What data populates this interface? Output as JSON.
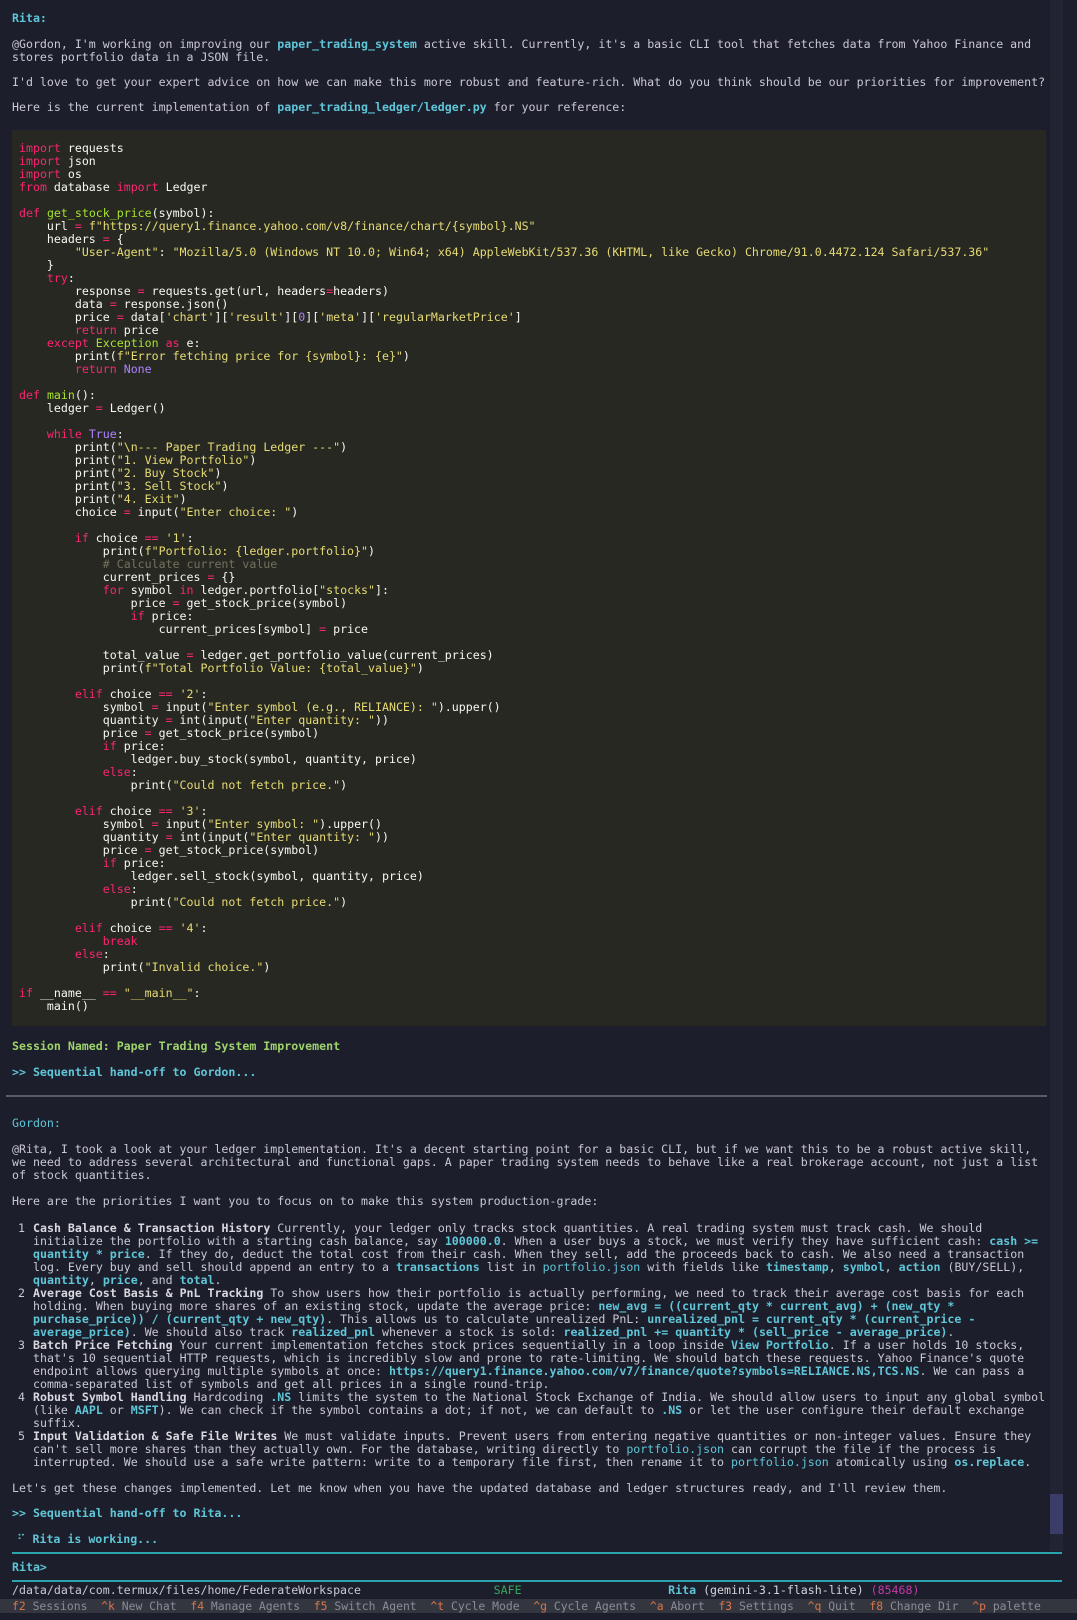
{
  "rita_block": {
    "speaker": "Rita:",
    "p1_a": "@Gordon, I'm working on improving our ",
    "p1_skill": "paper_trading_system",
    "p1_b": " active skill. Currently, it's a basic CLI tool that fetches data from Yahoo Finance and",
    "p1_c": "stores portfolio data in a JSON file.",
    "p2": "I'd love to get your expert advice on how we can make this more robust and feature-rich. What do you think should be our priorities for improvement?",
    "p3_a": "Here is the current implementation of ",
    "p3_file": "paper_trading_ledger/ledger.py",
    "p3_b": " for your reference:"
  },
  "session": {
    "named": "Session Named: Paper Trading System Improvement",
    "handoff_gordon": ">> Sequential hand-off to Gordon..."
  },
  "gordon_block": {
    "speaker": "Gordon:",
    "intro_1": "@Rita, I took a look at your ledger implementation. It's a decent starting point for a basic CLI, but if we want this to be a robust active skill,",
    "intro_2": "we need to address several architectural and functional gaps. A paper trading system needs to behave like a real brokerage account, not just a list",
    "intro_3": "of stock quantities.",
    "priorities": "Here are the priorities I want you to focus on to make this system production-grade:",
    "items": [
      {
        "num": "1",
        "title": "Cash Balance & Transaction History",
        "t1": " Currently, your ledger only tracks stock quantities. A real trading system must track cash. We should initialize the portfolio with a starting cash balance, say ",
        "c1": "100000.0",
        "t2": ". When a user buys a stock, we must verify they have sufficient cash: ",
        "c2": "cash >= quantity * price",
        "t3": ". If they do, deduct the total cost from their cash. When they sell, add the proceeds back to cash. We also need a transaction log. Every buy and sell should append an entry to a ",
        "c3": "transactions",
        "t4": " list in ",
        "c4": "portfolio.json",
        "t5": " with fields like ",
        "c5": "timestamp",
        "t6": ", ",
        "c6": "symbol",
        "t7": ", ",
        "c7": "action",
        "t8": " (BUY/SELL), ",
        "c8": "quantity",
        "t9": ", ",
        "c9": "price",
        "t10": ", and ",
        "c10": "total",
        "t11": "."
      },
      {
        "num": "2",
        "title": "Average Cost Basis & PnL Tracking",
        "t1": " To show users how their portfolio is actually performing, we need to track their average cost basis for each holding. When buying more shares of an existing stock, update the average price: ",
        "c1": "new_avg = ((current_qty * current_avg) + (new_qty * purchase_price)) / (current_qty + new_qty)",
        "t2": ". This allows us to calculate unrealized PnL: ",
        "c2": "unrealized_pnl = current_qty * (current_price - average_price)",
        "t3": ". We should also track ",
        "c3": "realized_pnl",
        "t4": " whenever a stock is sold: ",
        "c4": "realized_pnl += quantity * (sell_price - average_price)",
        "t5": "."
      },
      {
        "num": "3",
        "title": "Batch Price Fetching",
        "t1": " Your current implementation fetches stock prices sequentially in a loop inside ",
        "c1": "View Portfolio",
        "t2": ". If a user holds 10 stocks, that's 10 sequential HTTP requests, which is incredibly slow and prone to rate-limiting. We should batch these requests. Yahoo Finance's quote endpoint allows querying multiple symbols at once: ",
        "c2": "https://query1.finance.yahoo.com/v7/finance/quote?symbols=RELIANCE.NS,TCS.NS",
        "t3": ". We can pass a comma-separated list of symbols and get all prices in a single round-trip."
      },
      {
        "num": "4",
        "title": "Robust Symbol Handling",
        "t1": " Hardcoding ",
        "c1": ".NS",
        "t2": " limits the system to the National Stock Exchange of India. We should allow users to input any global symbol (like ",
        "c2": "AAPL",
        "t3": " or ",
        "c3": "MSFT",
        "t4": "). We can check if the symbol contains a dot; if not, we can default to ",
        "c4": ".NS",
        "t5": " or let the user configure their default exchange suffix."
      },
      {
        "num": "5",
        "title": "Input Validation & Safe File Writes",
        "t1": " We must validate inputs. Prevent users from entering negative quantities or non-integer values. Ensure they can't sell more shares than they actually own. For the database, writing directly to ",
        "c1": "portfolio.json",
        "t2": " can corrupt the file if the process is interrupted. We should use a safe write pattern: write to a temporary file first, then rename it to ",
        "c2": "portfolio.json",
        "t3": " atomically using ",
        "c3": "os.replace",
        "t4": "."
      }
    ],
    "closing": "Let's get these changes implemented. Let me know when you have the updated database and ledger structures ready, and I'll review them.",
    "handoff_rita": ">> Sequential hand-off to Rita...",
    "working": "Rita is working..."
  },
  "input": {
    "prompt": "Rita>"
  },
  "status": {
    "path": "/data/data/com.termux/files/home/FederateWorkspace",
    "mode": "SAFE",
    "agent": "Rita",
    "model": "(gemini-3.1-flash-lite)",
    "pid": "(85468)"
  },
  "fkeys": [
    {
      "k": "f2",
      "l": "Sessions"
    },
    {
      "k": "^k",
      "l": "New Chat"
    },
    {
      "k": "f4",
      "l": "Manage Agents"
    },
    {
      "k": "f5",
      "l": "Switch Agent"
    },
    {
      "k": "^t",
      "l": "Cycle Mode"
    },
    {
      "k": "^g",
      "l": "Cycle Agents"
    },
    {
      "k": "^a",
      "l": "Abort"
    },
    {
      "k": "f3",
      "l": "Settings"
    },
    {
      "k": "^q",
      "l": "Quit"
    },
    {
      "k": "f8",
      "l": "Change Dir"
    },
    {
      "k": "^p",
      "l": "palette"
    }
  ],
  "colors": {
    "background": "#1d1e2b",
    "accent": "#5fc6d8",
    "code_bg": "#272822",
    "session_green": "#9ed36b"
  }
}
